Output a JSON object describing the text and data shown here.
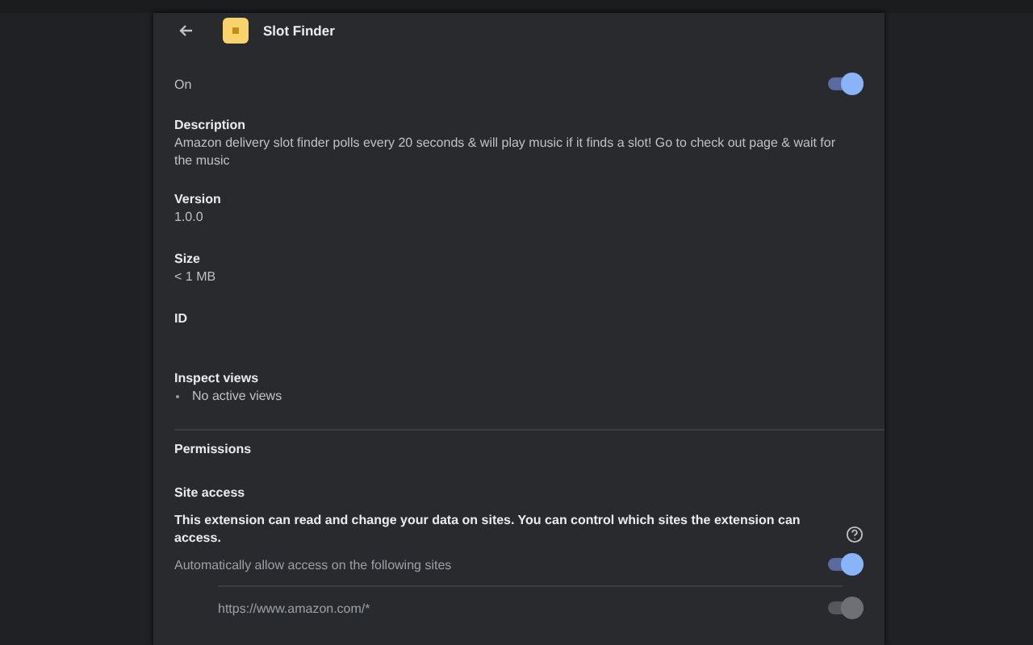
{
  "header": {
    "title": "Slot Finder"
  },
  "enabled": {
    "label": "On",
    "on": true
  },
  "details": [
    {
      "kind": "field",
      "label": "Description",
      "value": "Amazon delivery slot finder polls every 20 seconds & will play music if it finds a slot! Go to check out page & wait for the music"
    },
    {
      "kind": "field",
      "label": "Version",
      "value": "1.0.0"
    },
    {
      "kind": "field",
      "label": "Size",
      "value": "< 1 MB"
    },
    {
      "kind": "field",
      "label": "ID"
    },
    {
      "kind": "views",
      "label": "Inspect views",
      "items": [
        "No active views"
      ]
    }
  ],
  "permissions": {
    "title": "Permissions"
  },
  "site_access": {
    "title": "Site access",
    "description": "This extension can read and change your data on sites. You can control which sites the extension can access.",
    "auto_allow": {
      "label": "Automatically allow access on the following sites",
      "on": true
    },
    "sites": [
      {
        "url": "https://www.amazon.com/*",
        "on": true,
        "disabled": true
      }
    ]
  }
}
